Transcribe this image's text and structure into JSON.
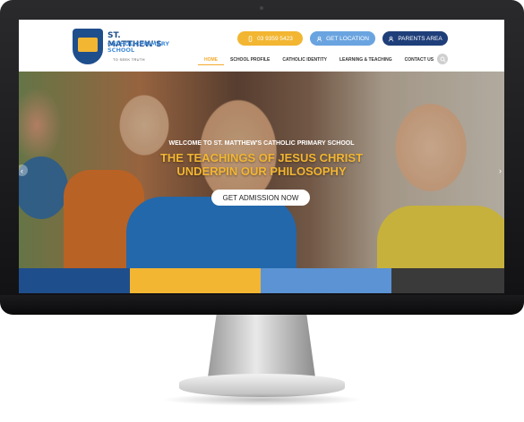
{
  "school": {
    "name": "ST. MATTHEW'S",
    "subname": "CATHOLICPRIMARY SCHOOL",
    "tagline": "TO SEEK TRUTH"
  },
  "header_buttons": {
    "phone": "03 9359 5423",
    "location": "GET LOCATION",
    "parents": "PARENTS AREA"
  },
  "nav": {
    "items": [
      "HOME",
      "SCHOOL PROFILE",
      "CATHOLIC IDENTITY",
      "LEARNING & TEACHING",
      "CONTACT US"
    ],
    "active": "HOME"
  },
  "hero": {
    "kicker": "WELCOME TO ST. MATTHEW'S CATHOLIC PRIMARY SCHOOL",
    "title_line1": "THE TEACHINGS OF JESUS CHRIST",
    "title_line2": "UNDERPIN OUR PHILOSOPHY",
    "button": "GET ADMISSION NOW",
    "prev_arrow": "‹",
    "next_arrow": "›"
  },
  "colors": {
    "brand_blue": "#1f4e8c",
    "accent_gold": "#f2b632",
    "light_blue": "#6aa4e0",
    "navy": "#1f3f7a"
  },
  "icons": [
    "phone-icon",
    "user-icon",
    "parents-icon",
    "search-icon",
    "arrow-left-icon",
    "arrow-right-icon"
  ]
}
